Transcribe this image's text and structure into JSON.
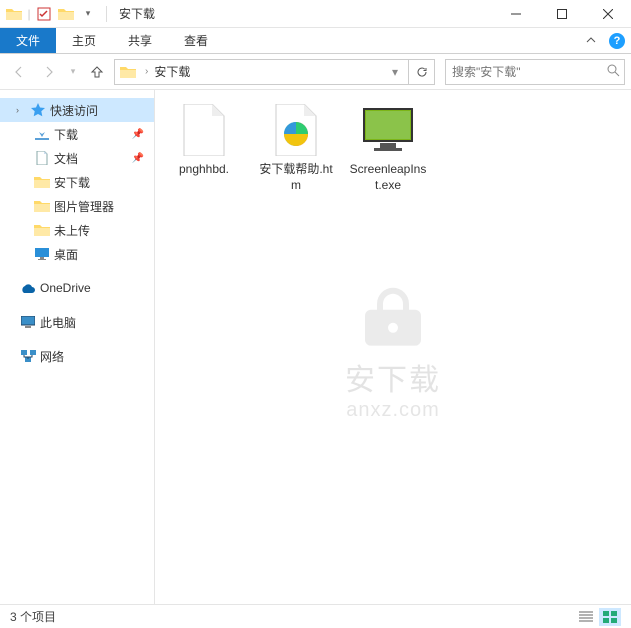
{
  "title": "安下载",
  "ribbon": {
    "file": "文件",
    "home": "主页",
    "share": "共享",
    "view": "查看"
  },
  "breadcrumb": {
    "current": "安下载"
  },
  "search": {
    "placeholder": "搜索\"安下载\""
  },
  "sidebar": {
    "quick_access": "快速访问",
    "downloads": "下载",
    "documents": "文档",
    "anxz": "安下载",
    "pic_manager": "图片管理器",
    "not_uploaded": "未上传",
    "desktop": "桌面",
    "onedrive": "OneDrive",
    "this_pc": "此电脑",
    "network": "网络"
  },
  "files": [
    {
      "name": "pnghhbd."
    },
    {
      "name": "安下载帮助.htm"
    },
    {
      "name": "ScreenleapInst.exe"
    }
  ],
  "watermark": {
    "text": "安下载",
    "sub": "anxz.com"
  },
  "status": {
    "count": "3 个项目"
  }
}
